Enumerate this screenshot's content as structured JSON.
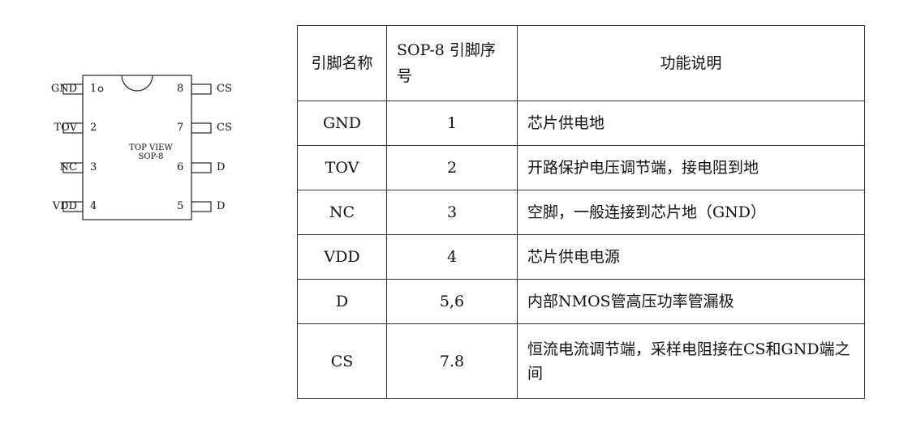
{
  "chip": {
    "top_text": "TOP VIEW",
    "package_text": "SOP-8",
    "left_pins": [
      {
        "name": "GND",
        "num": "1"
      },
      {
        "name": "TOV",
        "num": "2"
      },
      {
        "name": "NC",
        "num": "3"
      },
      {
        "name": "VDD",
        "num": "4"
      }
    ],
    "right_pins": [
      {
        "name": "CS",
        "num": "8"
      },
      {
        "name": "CS",
        "num": "7"
      },
      {
        "name": "D",
        "num": "6"
      },
      {
        "name": "D",
        "num": "5"
      }
    ]
  },
  "table": {
    "headers": [
      "引脚名称",
      "SOP-8 引脚序号",
      "功能说明"
    ],
    "rows": [
      {
        "name": "GND",
        "num": "1",
        "desc": "芯片供电地"
      },
      {
        "name": "TOV",
        "num": "2",
        "desc": "开路保护电压调节端，接电阻到地"
      },
      {
        "name": "NC",
        "num": "3",
        "desc": "空脚，一般连接到芯片地（GND）"
      },
      {
        "name": "VDD",
        "num": "4",
        "desc": "芯片供电电源"
      },
      {
        "name": "D",
        "num": "5,6",
        "desc": "内部NMOS管高压功率管漏极"
      },
      {
        "name": "CS",
        "num": "7.8",
        "desc": "恒流电流调节端，采样电阻接在CS和GND端之间"
      }
    ]
  }
}
